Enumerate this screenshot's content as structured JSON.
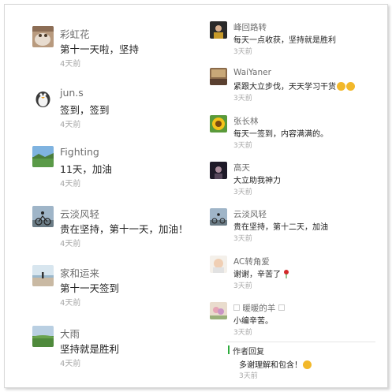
{
  "left_comments": [
    {
      "user": "彩虹花",
      "text": "第十一天啦，坚持",
      "time": "4天前",
      "avatar_icon": "cat-avatar-icon"
    },
    {
      "user": "jun.s",
      "text": "签到，签到",
      "time": "4天前",
      "avatar_icon": "penguin-avatar-icon"
    },
    {
      "user": "Fighting",
      "text": "11天，加油",
      "time": "4天前",
      "avatar_icon": "landscape-avatar-icon"
    },
    {
      "user": "云淡风轻",
      "text": "贵在坚持，第十一天，加油！",
      "time": "4天前",
      "avatar_icon": "cyclist-avatar-icon"
    },
    {
      "user": "家和运来",
      "text": "第十一天签到",
      "time": "4天前",
      "avatar_icon": "beach-avatar-icon"
    },
    {
      "user": "大雨",
      "text": "坚持就是胜利",
      "time": "4天前",
      "avatar_icon": "field-avatar-icon"
    }
  ],
  "right_comments": [
    {
      "user": "峰回路转",
      "text": "每天一点收获，坚持就是胜利",
      "time": "3天前",
      "avatar_icon": "portrait-avatar-icon"
    },
    {
      "user": "WaiYaner",
      "text": "紧跟大立步伐，天天学习干货",
      "time": "3天前",
      "avatar_icon": "room-avatar-icon",
      "emoji": "smile-emoji-icon"
    },
    {
      "user": "张长林",
      "text": "每天一签到，内容满满的。",
      "time": "3天前",
      "avatar_icon": "sunflower-avatar-icon"
    },
    {
      "user": "高天",
      "text": "大立助我神力",
      "time": "3天前",
      "avatar_icon": "night-avatar-icon"
    },
    {
      "user": "云淡风轻",
      "text": "贵在坚持，第十二天，加油",
      "time": "3天前",
      "avatar_icon": "cyclist-avatar-icon"
    },
    {
      "user": "AC转角爱",
      "text": "谢谢，辛苦了",
      "time": "3天前",
      "avatar_icon": "baby-avatar-icon",
      "emoji": "rose-icon"
    },
    {
      "user": "暖暖的羊",
      "text": "小编辛苦。",
      "time": "3天前",
      "avatar_icon": "flower-avatar-icon"
    }
  ],
  "author_reply": {
    "label": "作者回复",
    "text": "多谢理解和包含！",
    "time": "3天前",
    "emoji": "smile-emoji-icon"
  },
  "colors": {
    "accent_bar": "#2dab3c",
    "username": "#6d6d6d",
    "timestamp": "#a8a8a8"
  }
}
